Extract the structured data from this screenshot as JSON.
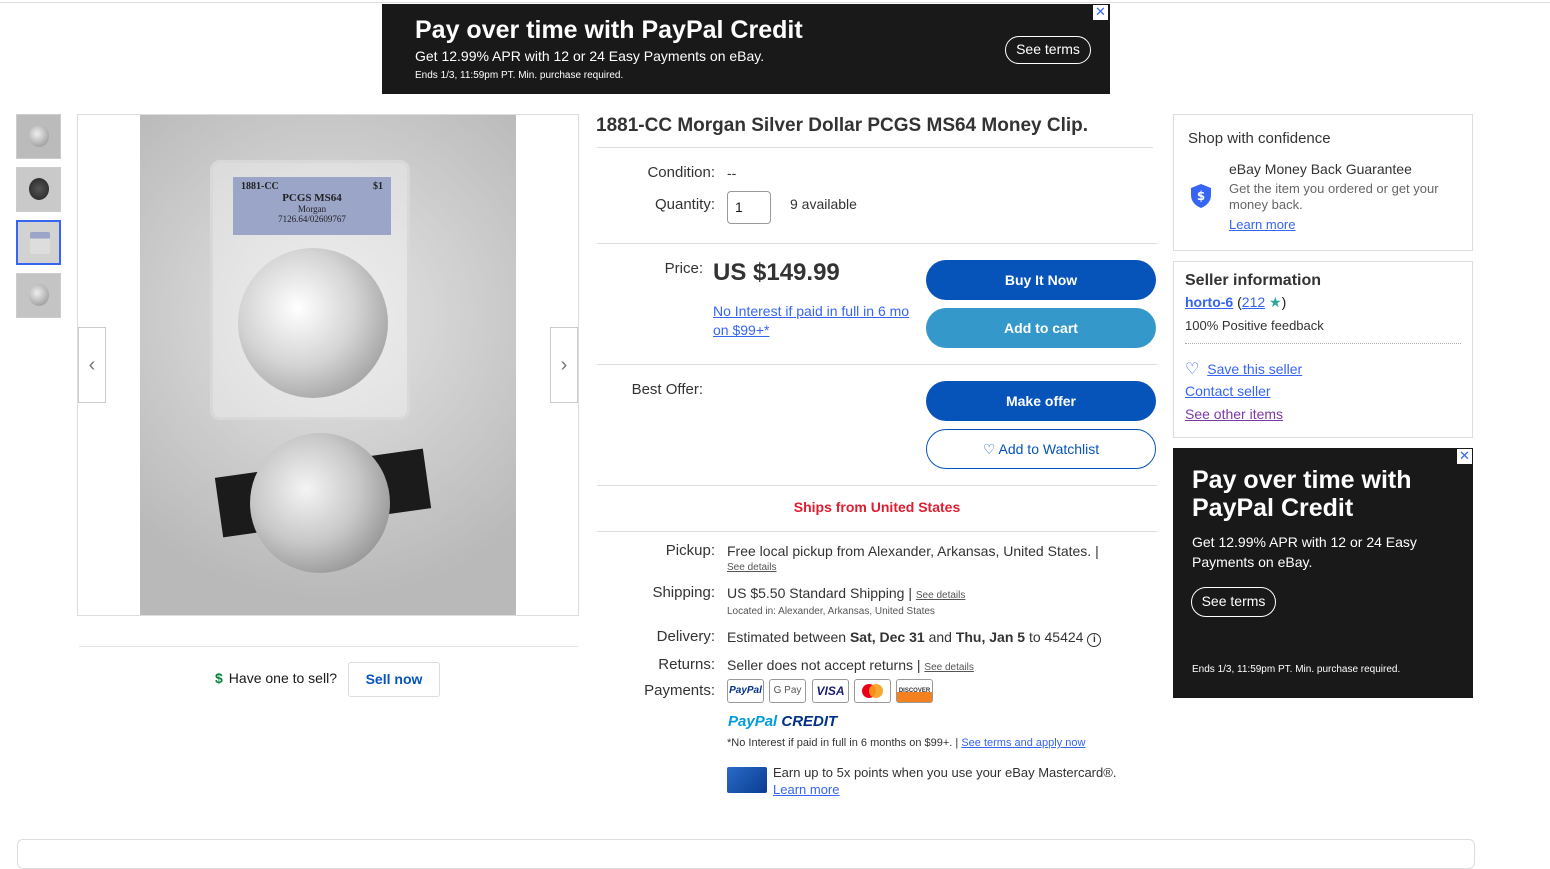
{
  "ad_top": {
    "headline": "Pay over time with PayPal Credit",
    "subline": "Get 12.99% APR with 12 or 24 Easy Payments on eBay.",
    "fineprint": "Ends 1/3, 11:59pm PT. Min. purchase required.",
    "terms_label": "See terms",
    "close_glyph": "✕"
  },
  "gallery": {
    "prev_glyph": "‹",
    "next_glyph": "›",
    "slab_label": {
      "line1": "1881-CC",
      "line2": "$1",
      "grade": "PCGS MS64",
      "variety": "Morgan",
      "cert": "7126.64/02609767"
    }
  },
  "sell": {
    "dollar_icon": "$",
    "question": "Have one to sell?",
    "button": "Sell now"
  },
  "listing": {
    "title": "1881-CC Morgan Silver Dollar PCGS MS64 Money Clip.",
    "condition_label": "Condition:",
    "condition_value": "--",
    "quantity_label": "Quantity:",
    "quantity_value": "1",
    "available": "9 available",
    "price_label": "Price:",
    "price": "US $149.99",
    "no_interest": "No Interest if paid in full in 6 mo on $99+*",
    "buy_now": "Buy It Now",
    "add_to_cart": "Add to cart",
    "best_offer_label": "Best Offer:",
    "make_offer": "Make offer",
    "watchlist": "♡ Add to Watchlist",
    "ships_from": "Ships from United States"
  },
  "details": {
    "pickup_label": "Pickup:",
    "pickup_text": "Free local pickup from Alexander, Arkansas, United States. |",
    "pickup_link": "See details",
    "shipping_label": "Shipping:",
    "shipping_price": "US $5.50",
    "shipping_text": "Standard Shipping |",
    "shipping_link": "See details",
    "located": "Located in: Alexander, Arkansas, United States",
    "delivery_label": "Delivery:",
    "delivery_prefix": "Estimated between",
    "delivery_from": "Sat, Dec 31",
    "delivery_and": "and",
    "delivery_to": "Thu, Jan 5",
    "delivery_zip": "to 45424",
    "info_icon": "i",
    "returns_label": "Returns:",
    "returns_text": "Seller does not accept returns |",
    "returns_link": "See details",
    "payments_label": "Payments:",
    "payment_methods": [
      "PayPal",
      "G Pay",
      "VISA",
      "Mastercard",
      "DISCOVER"
    ],
    "ppc_pay": "PayPal",
    "ppc_credit": "CREDIT",
    "ppc_note": "*No Interest if paid in full in 6 months on $99+. |",
    "ppc_link": "See terms and apply now",
    "mc_text": "Earn up to 5x points when you use your eBay Mastercard®.",
    "mc_link": "Learn more"
  },
  "confidence": {
    "heading": "Shop with confidence",
    "guarantee_title": "eBay Money Back Guarantee",
    "guarantee_text": "Get the item you ordered or get your money back.",
    "learn_more": "Learn more"
  },
  "seller": {
    "heading": "Seller information",
    "name": "horto-6",
    "feedback_open": "(",
    "feedback_count": "212",
    "feedback_close": ")",
    "positive": "100% Positive feedback",
    "save": "Save this seller",
    "contact": "Contact seller",
    "other_items": "See other items"
  },
  "ad_right": {
    "headline": "Pay over time with PayPal Credit",
    "subline": "Get 12.99% APR with 12 or 24 Easy Payments on eBay.",
    "terms_label": "See terms",
    "fineprint": "Ends 1/3, 11:59pm PT. Min. purchase required.",
    "close_glyph": "✕"
  }
}
